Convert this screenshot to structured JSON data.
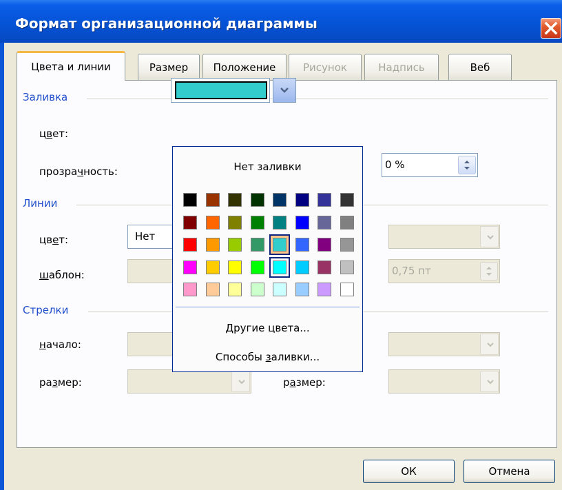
{
  "window": {
    "title": "Формат организационной диаграммы"
  },
  "tabs": [
    {
      "label": "Цвета и линии",
      "state": "active"
    },
    {
      "label": "Размер",
      "state": "enabled"
    },
    {
      "label": "Положение",
      "state": "enabled"
    },
    {
      "label": "Рисунок",
      "state": "disabled"
    },
    {
      "label": "Надпись",
      "state": "disabled"
    },
    {
      "label": "Веб",
      "state": "enabled"
    }
  ],
  "fill": {
    "group_title": "Заливка",
    "color_label": "цвет:",
    "transparency_label": "прозрачность:",
    "transparency_value": "0 %",
    "selected_color": "#33CCCC"
  },
  "lines": {
    "group_title": "Линии",
    "color_label": "цвет:",
    "color_value": "Нет",
    "pattern_label": "шаблон:",
    "weight_value": "0,75 пт"
  },
  "arrows": {
    "group_title": "Стрелки",
    "start_label": "начало:",
    "size_label": "размер:",
    "end_size_label": "размер:"
  },
  "color_popup": {
    "no_fill": "Нет заливки",
    "more_colors": "Другие цвета...",
    "fill_effects": "Способы заливки...",
    "hover_color": "#33CCCC",
    "selected_color": "#00FFFF",
    "colors": [
      [
        "#000000",
        "#993300",
        "#333300",
        "#003300",
        "#003366",
        "#000080",
        "#333399",
        "#333333"
      ],
      [
        "#800000",
        "#FF6600",
        "#808000",
        "#008000",
        "#008080",
        "#0000FF",
        "#666699",
        "#808080"
      ],
      [
        "#FF0000",
        "#FF9900",
        "#99CC00",
        "#339966",
        "#33CCCC",
        "#3366FF",
        "#800080",
        "#969696"
      ],
      [
        "#FF00FF",
        "#FFCC00",
        "#FFFF00",
        "#00FF00",
        "#00FFFF",
        "#00CCFF",
        "#993366",
        "#C0C0C0"
      ],
      [
        "#FF99CC",
        "#FFCC99",
        "#FFFF99",
        "#CCFFCC",
        "#CCFFFF",
        "#99CCFF",
        "#CC99FF",
        "#FFFFFF"
      ]
    ]
  },
  "buttons": {
    "ok": "ОК",
    "cancel": "Отмена"
  }
}
